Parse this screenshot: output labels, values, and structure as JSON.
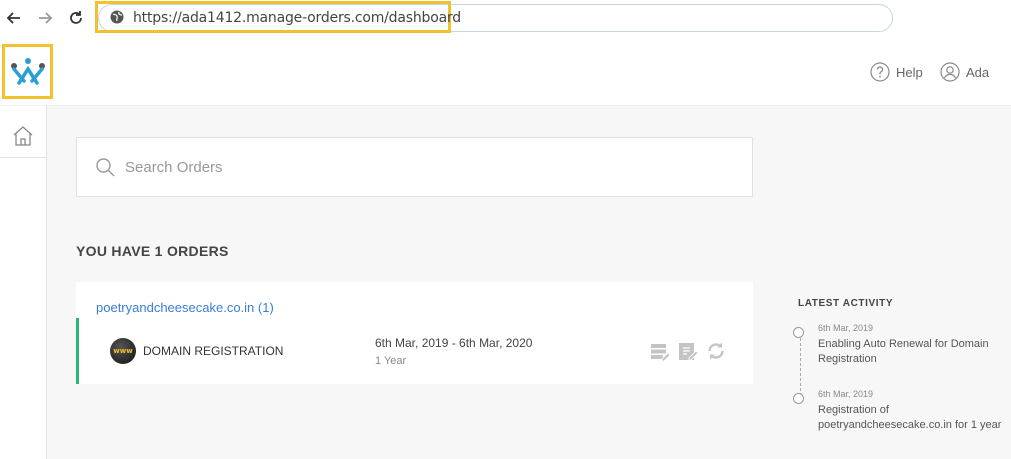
{
  "browser": {
    "url": "https://ada1412.manage-orders.com/dashboard"
  },
  "header": {
    "help_label": "Help",
    "user_label": "Ada"
  },
  "search": {
    "placeholder": "Search Orders"
  },
  "orders": {
    "heading": "YOU HAVE 1 ORDERS",
    "groups": [
      {
        "domain": "poetryandcheesecake.co.in (1)",
        "items": [
          {
            "badge": "www",
            "product": "DOMAIN REGISTRATION",
            "dates": "6th Mar, 2019 - 6th Mar, 2020",
            "term": "1 Year"
          }
        ]
      }
    ]
  },
  "activity": {
    "heading": "LATEST ACTIVITY",
    "items": [
      {
        "date": "6th Mar, 2019",
        "text": "Enabling Auto Renewal for Domain Registration"
      },
      {
        "date": "6th Mar, 2019",
        "text": "Registration of poetryandcheesecake.co.in for 1 year"
      }
    ]
  },
  "colors": {
    "accent_yellow": "#f2c12e",
    "link_blue": "#3b7dd8",
    "status_green": "#2bb673",
    "logo_blue": "#2a9fd6",
    "logo_grey": "#555555"
  },
  "icons": {
    "back": "arrow-left-icon",
    "forward": "arrow-right-icon",
    "reload": "reload-icon",
    "globe": "globe-icon",
    "help": "question-circle-icon",
    "user": "user-circle-icon",
    "home": "home-icon",
    "search": "search-icon",
    "manage_dns": "manage-dns-icon",
    "edit": "edit-icon",
    "renew": "renew-icon"
  }
}
